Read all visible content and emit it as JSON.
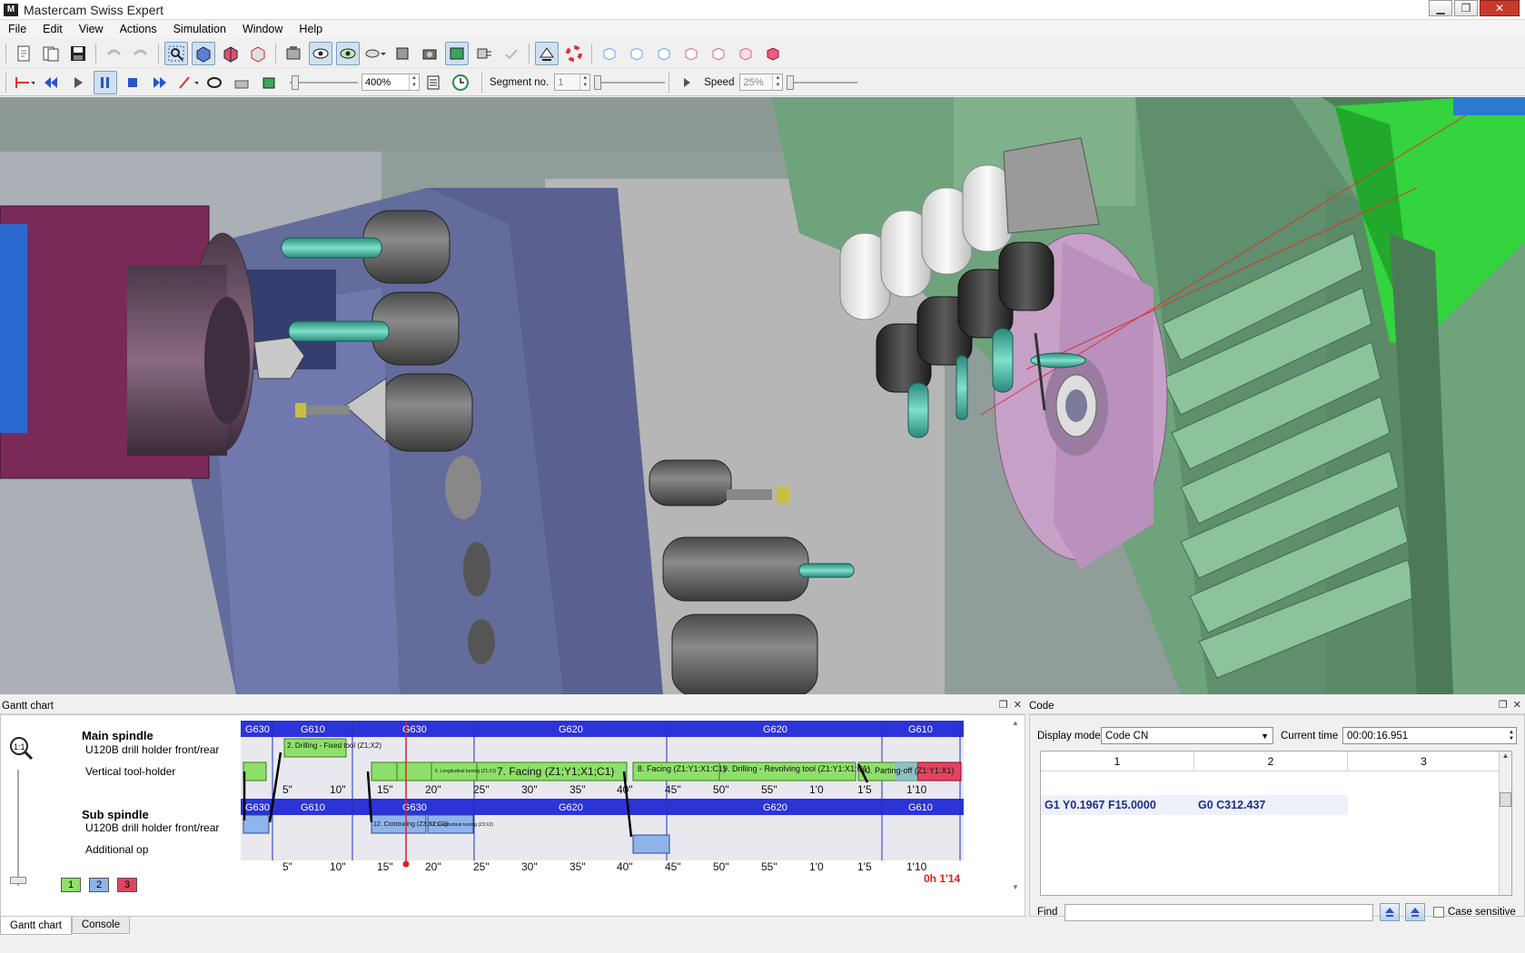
{
  "window": {
    "title": "Mastercam Swiss Expert",
    "logo_text": "M",
    "controls": [
      "minimize-icon",
      "restore-icon",
      "close-icon"
    ]
  },
  "menu": {
    "items": [
      {
        "label": "File"
      },
      {
        "label": "Edit"
      },
      {
        "label": "View"
      },
      {
        "label": "Actions"
      },
      {
        "label": "Simulation"
      },
      {
        "label": "Window"
      },
      {
        "label": "Help"
      }
    ]
  },
  "toolbar2": {
    "zoom_value": "400%",
    "segment_label": "Segment no.",
    "segment_value": "1",
    "speed_label": "Speed",
    "speed_value": "25%"
  },
  "gantt": {
    "title": "Gantt chart",
    "main_spindle": {
      "label": "Main spindle",
      "row1": "U120B drill holder front/rear",
      "row2": "Vertical tool-holder"
    },
    "sub_spindle": {
      "label": "Sub spindle",
      "row1": "U120B drill holder front/rear",
      "row2": "Additional op"
    },
    "main_gcodes": [
      "G630",
      "G610",
      "G630",
      "G620",
      "G620",
      "G610"
    ],
    "sub_gcodes": [
      "G630",
      "G610",
      "G630",
      "G620",
      "G620",
      "G610"
    ],
    "ticks": [
      "5\"",
      "10\"",
      "15\"",
      "20\"",
      "25\"",
      "30\"",
      "35\"",
      "40\"",
      "45\"",
      "50\"",
      "55\"",
      "1'0",
      "1'5",
      "1'10"
    ],
    "op_labels": {
      "op2": "2. Drilling - Fixed tool (Z1;X2)",
      "op7": "7. Facing (Z1;Y1;X1;C1)",
      "op8": "8. Facing (Z1:Y1:X1:C1)",
      "op9": "9. Drilling - Revolving tool (Z1:Y1:X1:C1)",
      "op10": "10. Parting-off (Z1:Y1:X1)",
      "op12": "12. Contouring (Z3;X2;C2)",
      "op13": "13. Longitudinal turning (Z3;X2)",
      "op_long": "6. Longitudinal turning (Z1;X1)"
    },
    "total_time": "0h 1'14",
    "legend": [
      "1",
      "2",
      "3"
    ],
    "colors": {
      "green": "#8ee06a",
      "blue": "#8fb4ea",
      "red": "#e0455f",
      "header": "#2c33d8"
    }
  },
  "tabs": [
    "Gantt chart",
    "Console"
  ],
  "code": {
    "title": "Code",
    "display_mode_label": "Display mode",
    "display_mode_value": "Code CN",
    "current_time_label": "Current time",
    "current_time_value": "00:00:16.951",
    "columns": [
      "1",
      "2",
      "3"
    ],
    "cells": [
      "G1 Y0.1967 F15.0000",
      "G0 C312.437",
      ""
    ],
    "find_label": "Find",
    "case_sensitive_label": "Case sensitive"
  }
}
